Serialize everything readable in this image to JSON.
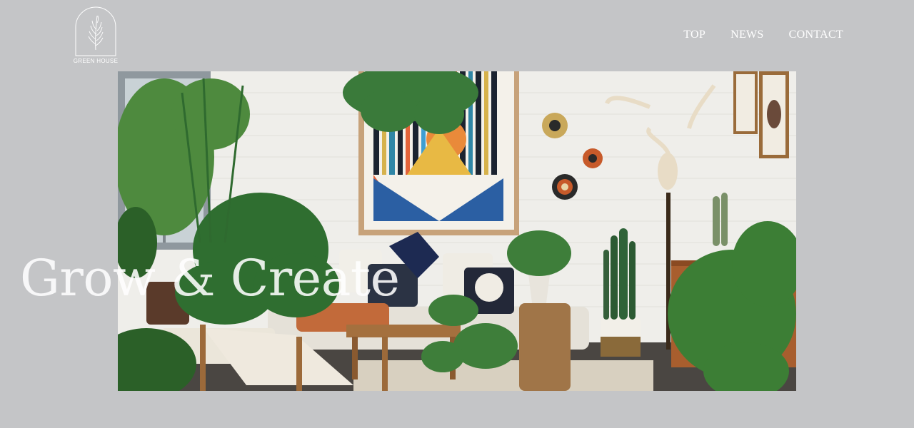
{
  "brand": {
    "name": "GREEN HOUSE",
    "logo_icon": "leaf-arch-icon"
  },
  "nav": {
    "items": [
      {
        "label": "TOP"
      },
      {
        "label": "NEWS"
      },
      {
        "label": "CONTACT"
      }
    ]
  },
  "hero": {
    "headline": "Grow & Create",
    "image": "interior-living-room-with-plants-photo"
  },
  "colors": {
    "page_background": "#c4c5c7",
    "nav_text": "#ffffff"
  }
}
